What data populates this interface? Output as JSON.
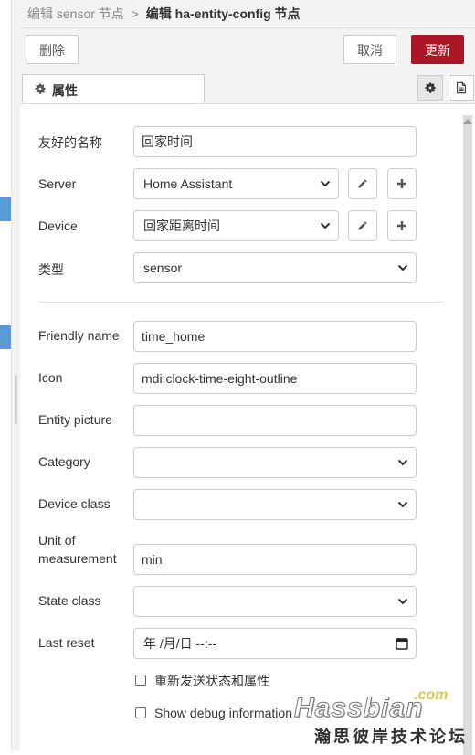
{
  "breadcrumb": {
    "parent": "编辑 sensor 节点",
    "separator": ">",
    "current": "编辑 ha-entity-config 节点"
  },
  "toolbar": {
    "delete_label": "删除",
    "cancel_label": "取消",
    "update_label": "更新"
  },
  "tabs": {
    "properties_label": "属性"
  },
  "form": {
    "friendly_name_cn": {
      "label": "友好的名称",
      "value": "回家时间"
    },
    "server": {
      "label": "Server",
      "value": "Home Assistant"
    },
    "device": {
      "label": "Device",
      "value": "回家距离时间"
    },
    "type": {
      "label": "类型",
      "value": "sensor"
    },
    "friendly_name": {
      "label": "Friendly name",
      "value": "time_home"
    },
    "icon": {
      "label": "Icon",
      "value": "mdi:clock-time-eight-outline"
    },
    "entity_picture": {
      "label": "Entity picture",
      "value": ""
    },
    "category": {
      "label": "Category",
      "value": ""
    },
    "device_class": {
      "label": "Device class",
      "value": ""
    },
    "unit_of_measurement": {
      "label_line1": "Unit of",
      "label_line2": "measurement",
      "value": "min"
    },
    "state_class": {
      "label": "State class",
      "value": ""
    },
    "last_reset": {
      "label": "Last reset",
      "value": "年 /月/日  --:--"
    },
    "resend_checkbox": {
      "label": "重新发送状态和属性"
    },
    "debug_checkbox": {
      "label": "Show debug information"
    }
  },
  "watermark": {
    "com": ".com",
    "brand": "Hassbian",
    "subtitle": "瀚思彼岸技术论坛"
  },
  "colors": {
    "update_button": "#ad1625",
    "workspace_node": "#5b9bd5"
  }
}
